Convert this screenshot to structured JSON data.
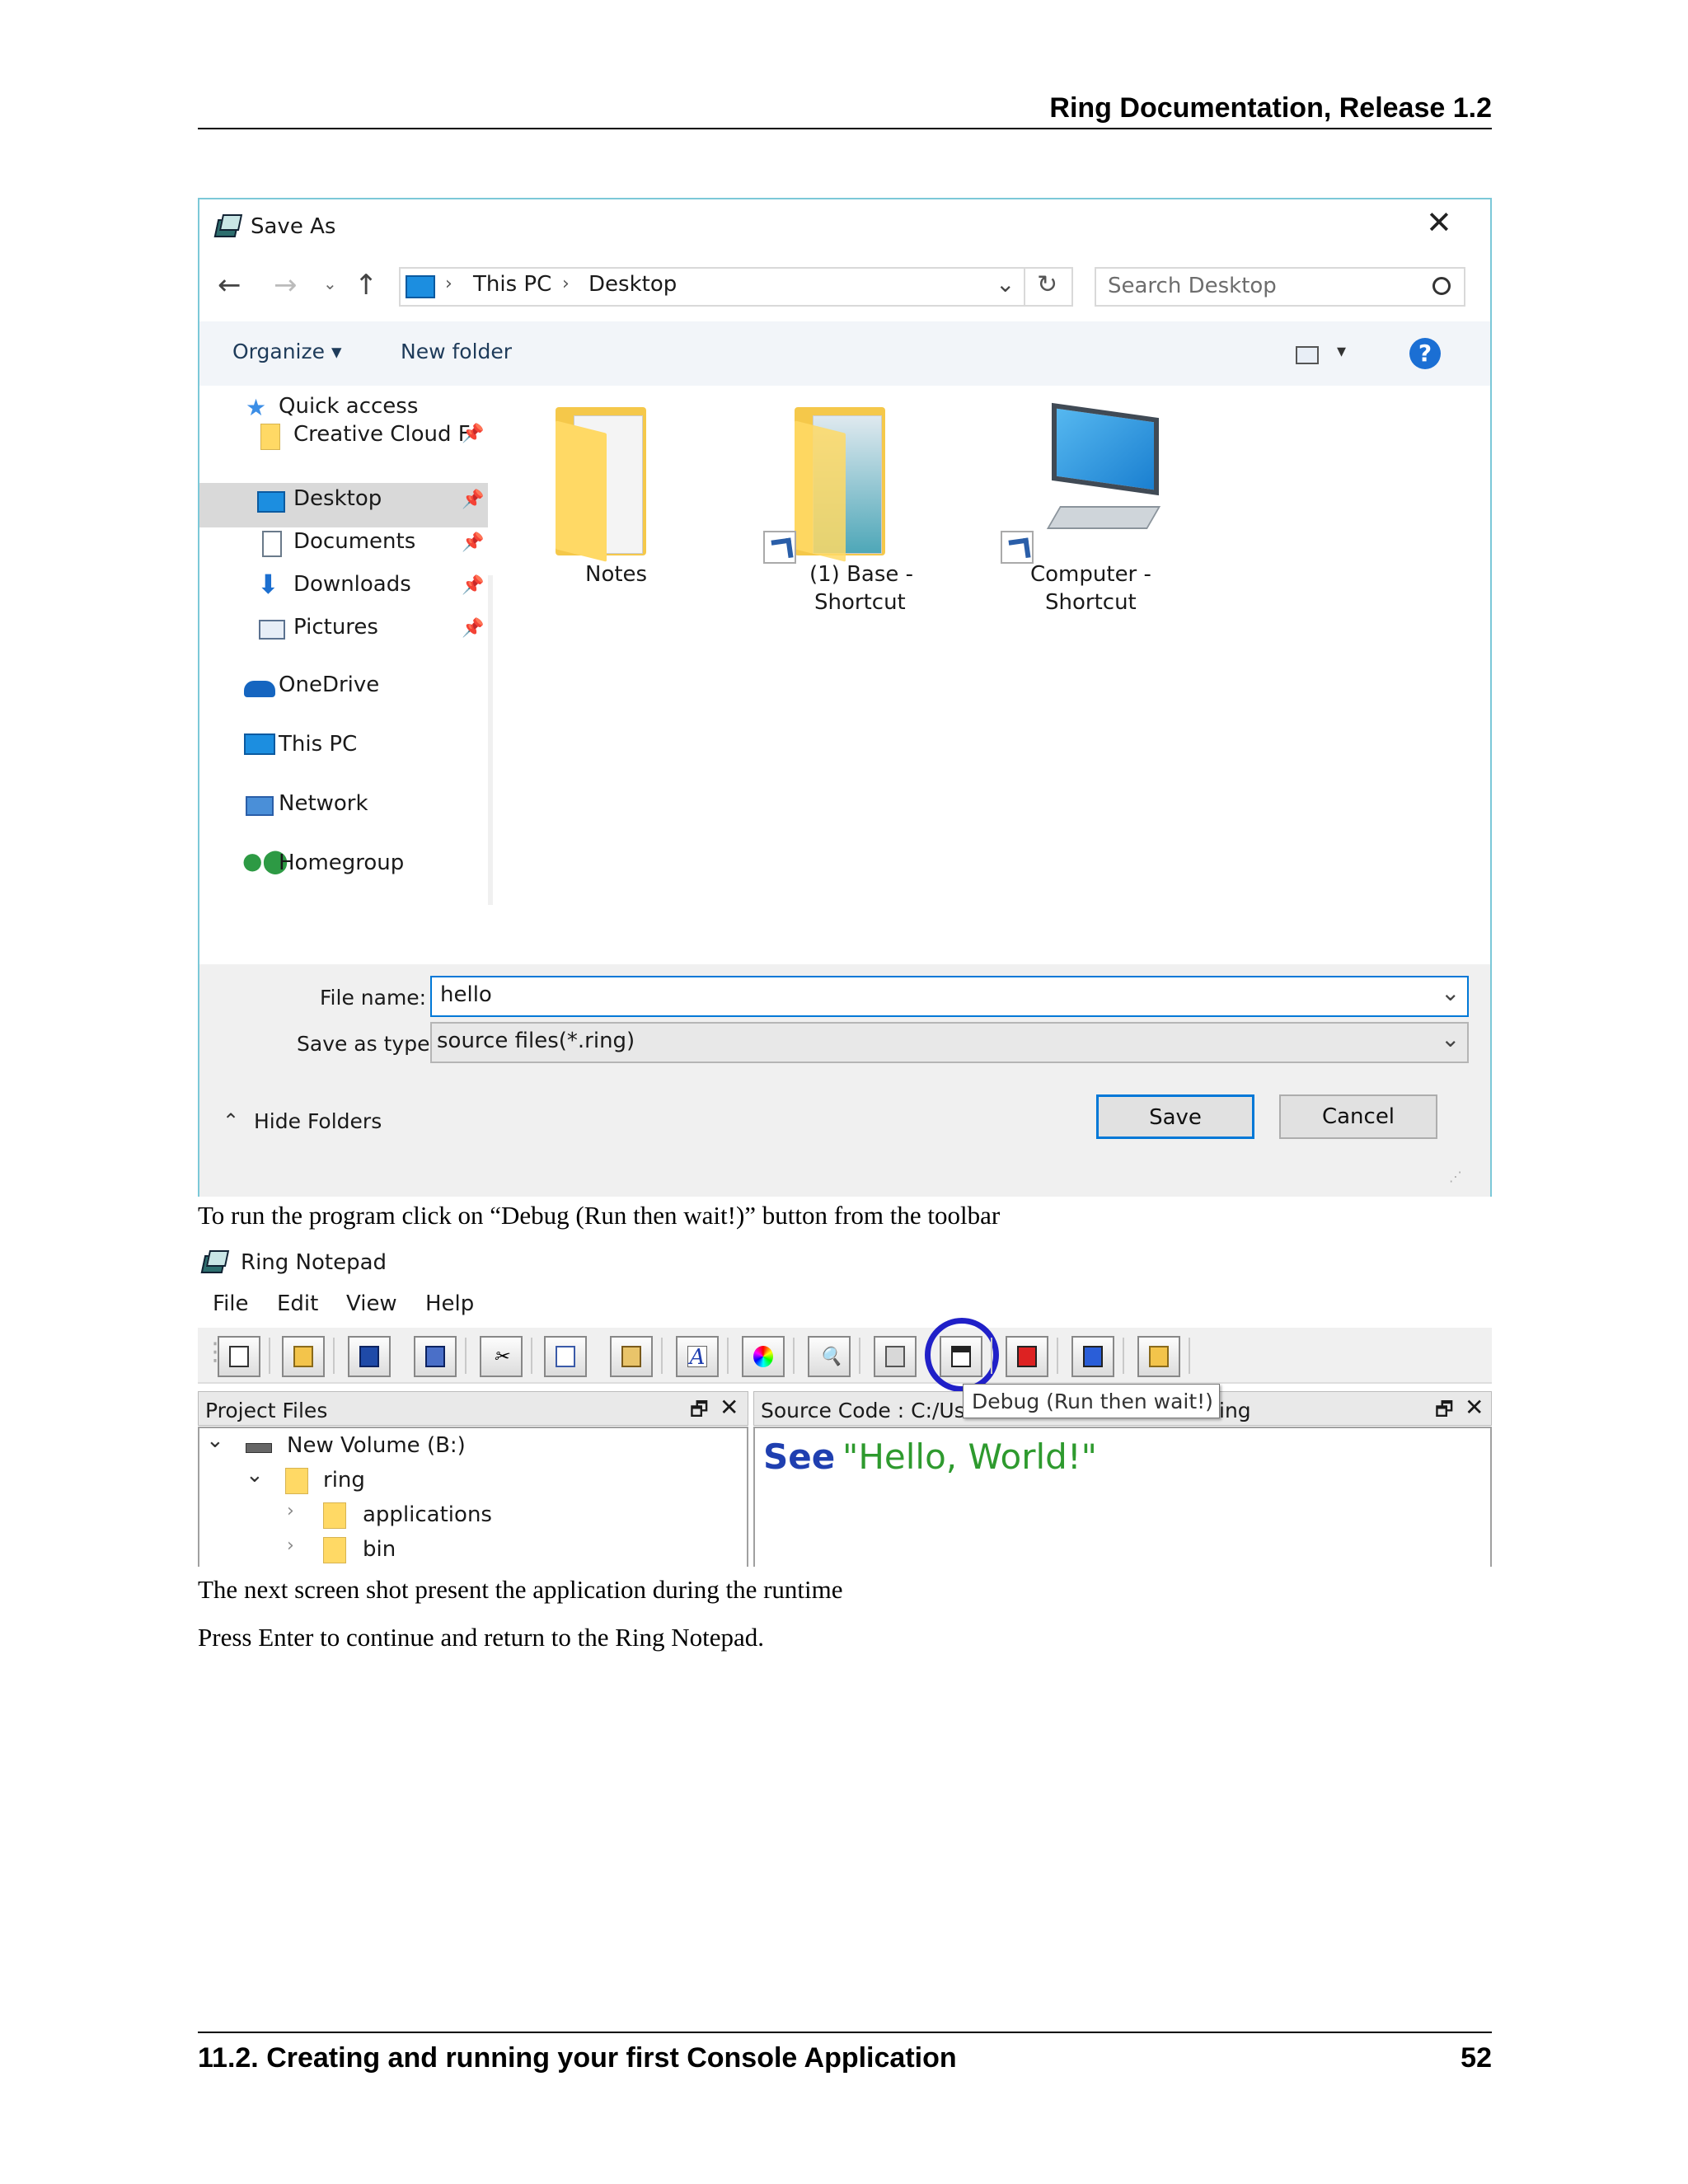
{
  "header": {
    "title": "Ring Documentation, Release 1.2"
  },
  "footer": {
    "section": "11.2. Creating and running your first Console Application",
    "page": "52"
  },
  "save_dialog": {
    "title": "Save As",
    "path": [
      "This PC",
      "Desktop"
    ],
    "search_placeholder": "Search Desktop",
    "organize": "Organize",
    "new_folder": "New folder",
    "nav": {
      "quick_access": "Quick access",
      "items": [
        "Creative Cloud F",
        "Desktop",
        "Documents",
        "Downloads",
        "Pictures"
      ],
      "onedrive": "OneDrive",
      "this_pc": "This PC",
      "network": "Network",
      "homegroup": "Homegroup"
    },
    "files": [
      {
        "line1": "Notes",
        "line2": ""
      },
      {
        "line1": "(1) Base -",
        "line2": "Shortcut"
      },
      {
        "line1": "Computer -",
        "line2": "Shortcut"
      }
    ],
    "file_name_label": "File name:",
    "file_name_value": "hello",
    "save_type_label": "Save as type:",
    "save_type_value": "source files(*.ring)",
    "hide_folders": "Hide Folders",
    "save_button": "Save",
    "cancel_button": "Cancel"
  },
  "text": {
    "para1": "To run the program click on “Debug (Run then wait!)” button from the toolbar",
    "para2": "The next screen shot present the application during the runtime",
    "para3": "Press Enter to continue and return to the Ring Notepad."
  },
  "notepad": {
    "title": "Ring Notepad",
    "menu": [
      "File",
      "Edit",
      "View",
      "Help"
    ],
    "project_files": "Project Files",
    "tree": [
      "New Volume (B:)",
      "ring",
      "applications",
      "bin"
    ],
    "source_prefix": "Source Code : C:/User",
    "source_suffix": "ing",
    "tooltip": "Debug (Run then wait!)",
    "code_keyword": "See",
    "code_string": "\"Hello, World!\"",
    "colors": {
      "keyword": "#1f3fb0",
      "string": "#2e9a2e",
      "highlight": "#2020c8"
    }
  }
}
